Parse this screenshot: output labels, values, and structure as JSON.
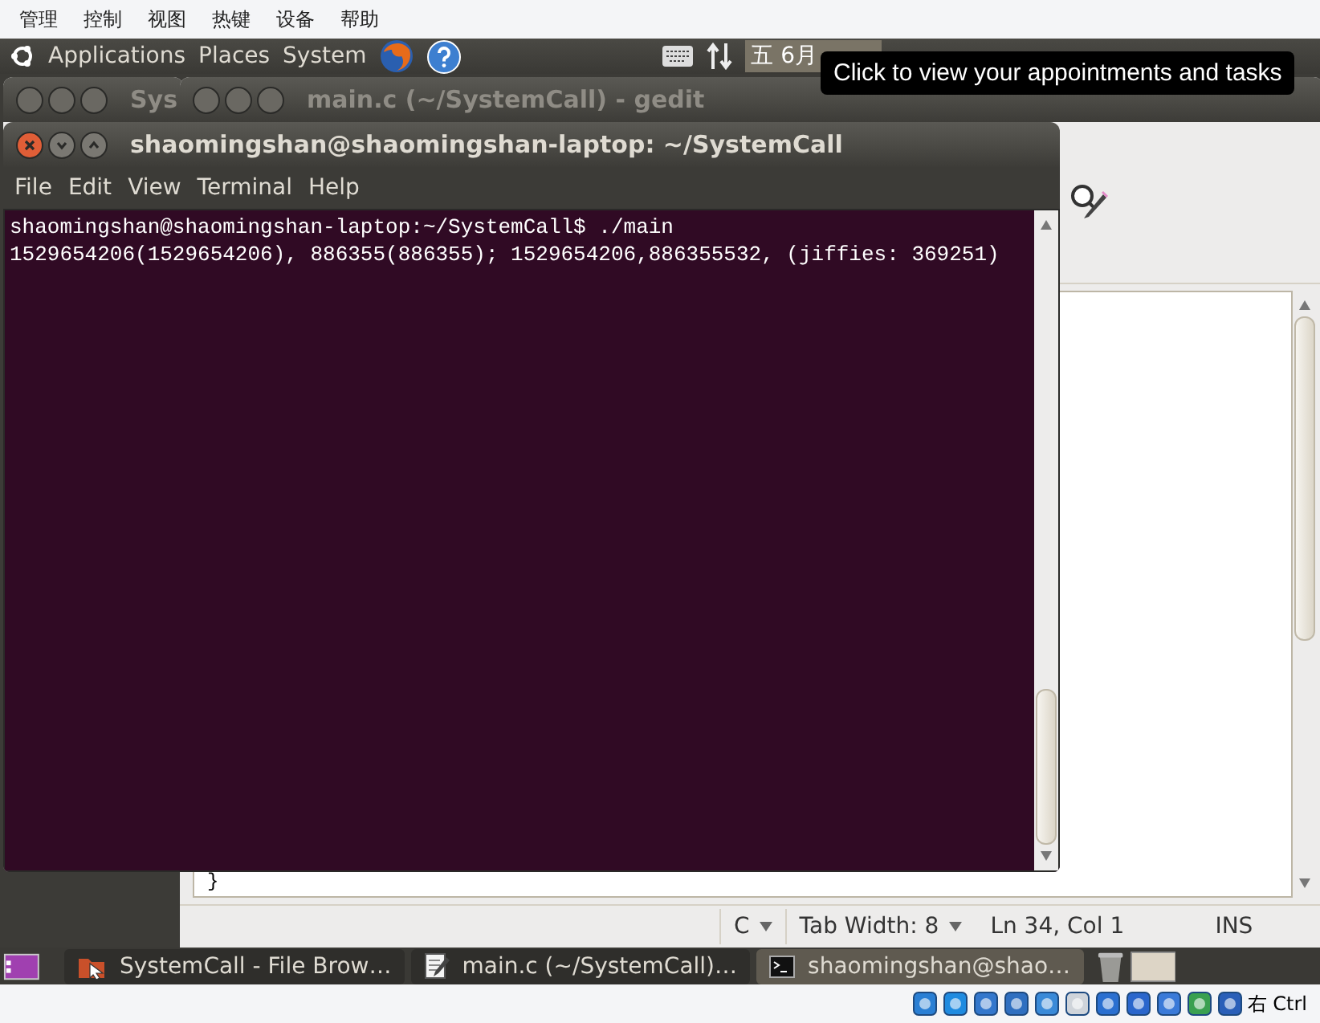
{
  "host_menu": [
    "管理",
    "控制",
    "视图",
    "热键",
    "设备",
    "帮助"
  ],
  "top_panel": {
    "menus": [
      "Applications",
      "Places",
      "System"
    ],
    "clock": "五 6月"
  },
  "tooltip": "Click to view your appointments and tasks",
  "file_browser": {
    "title": "Sys"
  },
  "gedit": {
    "title": "main.c (~/SystemCall) - gedit",
    "code_lines": [
      "}"
    ],
    "status": {
      "language": "C",
      "tab_width": "Tab Width:  8",
      "position": "Ln 34, Col 1",
      "mode": "INS"
    }
  },
  "terminal": {
    "title": "shaomingshan@shaomingshan-laptop: ~/SystemCall",
    "menu": [
      "File",
      "Edit",
      "View",
      "Terminal",
      "Help"
    ],
    "lines": [
      "shaomingshan@shaomingshan-laptop:~/SystemCall$ ./main",
      "1529654206(1529654206), 886355(886355); 1529654206,886355532, (jiffies: 369251)"
    ]
  },
  "taskbar": [
    {
      "label": "SystemCall - File Brow…",
      "kind": "files",
      "selected": false
    },
    {
      "label": "main.c (~/SystemCall)…",
      "kind": "editor",
      "selected": false
    },
    {
      "label": "shaomingshan@shao…",
      "kind": "terminal",
      "selected": true
    }
  ],
  "host_status": {
    "key_label": "右 Ctrl"
  }
}
